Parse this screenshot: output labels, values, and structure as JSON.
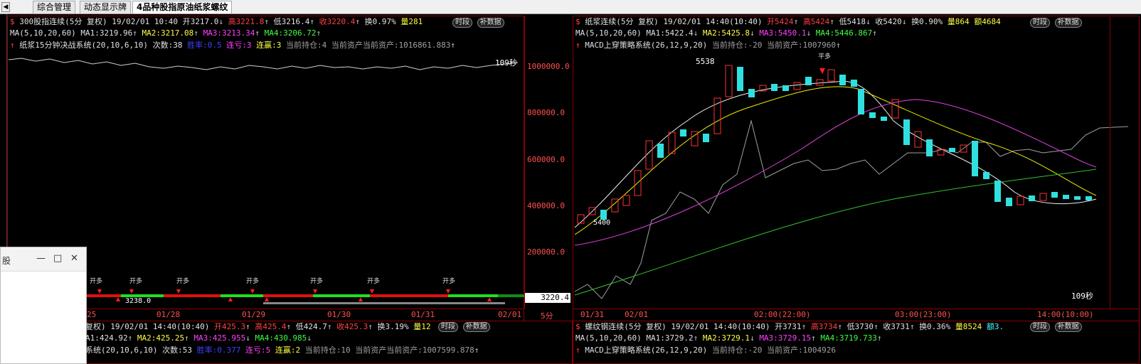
{
  "tabs": [
    "综合管理",
    "动态显示牌",
    "4品种股指原油纸浆螺纹"
  ],
  "nav_arrow": "◀",
  "colors": {
    "up": "#ff4040",
    "down": "#40ffff",
    "border": "#8b0000"
  },
  "left_top": {
    "header": [
      "300股指连续(5分 复权) 19/02/01 10:40",
      "开3217.0",
      "高3221.8",
      "低3216.4",
      "收3220.4",
      "换0.97%",
      "量281"
    ],
    "ma_line": [
      "MA(5,10,20,60)",
      "MA1:3219.96",
      "MA2:3217.08",
      "MA3:3213.34",
      "MA4:3206.72"
    ],
    "sys_line": [
      "纸浆15分钟决战系统(20,10,6,10)",
      "次数:38",
      "胜率:0.5",
      "连亏:3",
      "连赢:3",
      "当前持仓:4",
      "当前资产当前资产:1016861.883"
    ],
    "y_ticks": [
      "1000000.0",
      "800000.0",
      "600000.0",
      "400000.0",
      "200000.0"
    ],
    "last_price": "3220.4",
    "timer": "109秒",
    "low_label": "3238.0",
    "x_labels": [
      "25",
      "01/28",
      "01/29",
      "01/30",
      "01/31",
      "02/01"
    ],
    "period": "5分",
    "signal_label": "开多"
  },
  "right_top": {
    "header": [
      "纸浆连续(5分 复权) 19/02/01 14:40(10:40)",
      "开5424",
      "高5424",
      "低5418",
      "收5420",
      "换0.90%",
      "量864",
      "额4684"
    ],
    "ma_line": [
      "MA(5,10,20,60)",
      "MA1:5422.4",
      "MA2:5425.8",
      "MA3:5450.1",
      "MA4:5446.867"
    ],
    "sys_line": [
      "MACD上穿策略系统(26,12,9,20)",
      "当前持仓:-20",
      "当前资产:1007960"
    ],
    "high_label": "5538",
    "low_label": "5400",
    "timer": "109秒",
    "x_labels": [
      "01/31",
      "02/01",
      "02:00(22:00)",
      "03:00(23:00)",
      "14:00(10:00)"
    ],
    "signal_label": "平多"
  },
  "left_bottom": {
    "header": [
      "复权) 19/02/01 14:40(10:40)",
      "开425.3",
      "高425.4",
      "低424.7",
      "收425.3",
      "换3.19%",
      "量12"
    ],
    "ma_line": [
      "A1:424.92",
      "MA2:425.25",
      "MA3:425.955",
      "MA4:430.985"
    ],
    "sys_line": [
      "系统(20,10,6,10)",
      "次数:53",
      "胜率:0.377",
      "连亏:5",
      "连赢:2",
      "当前持仓:10",
      "当前资产当前资产:1007599.878"
    ]
  },
  "right_bottom": {
    "header": [
      "螺纹钢连续(5分 复权) 19/02/01 14:40(10:40)",
      "开3731",
      "高3734",
      "低3730",
      "收3731",
      "换0.36%",
      "量8524",
      "额3."
    ],
    "ma_line": [
      "MA(5,10,20,60)",
      "MA1:3729.2",
      "MA2:3729.1",
      "MA3:3729.15",
      "MA4:3719.733"
    ],
    "sys_line": [
      "MACD上穿策略系统(26,12,9,20)",
      "当前持仓:-20",
      "当前资产:1004926"
    ]
  },
  "buttons": {
    "period": "时段",
    "supplement": "补数据"
  },
  "popup": {
    "label": "股",
    "min": "—",
    "max": "□",
    "close": "✕"
  }
}
